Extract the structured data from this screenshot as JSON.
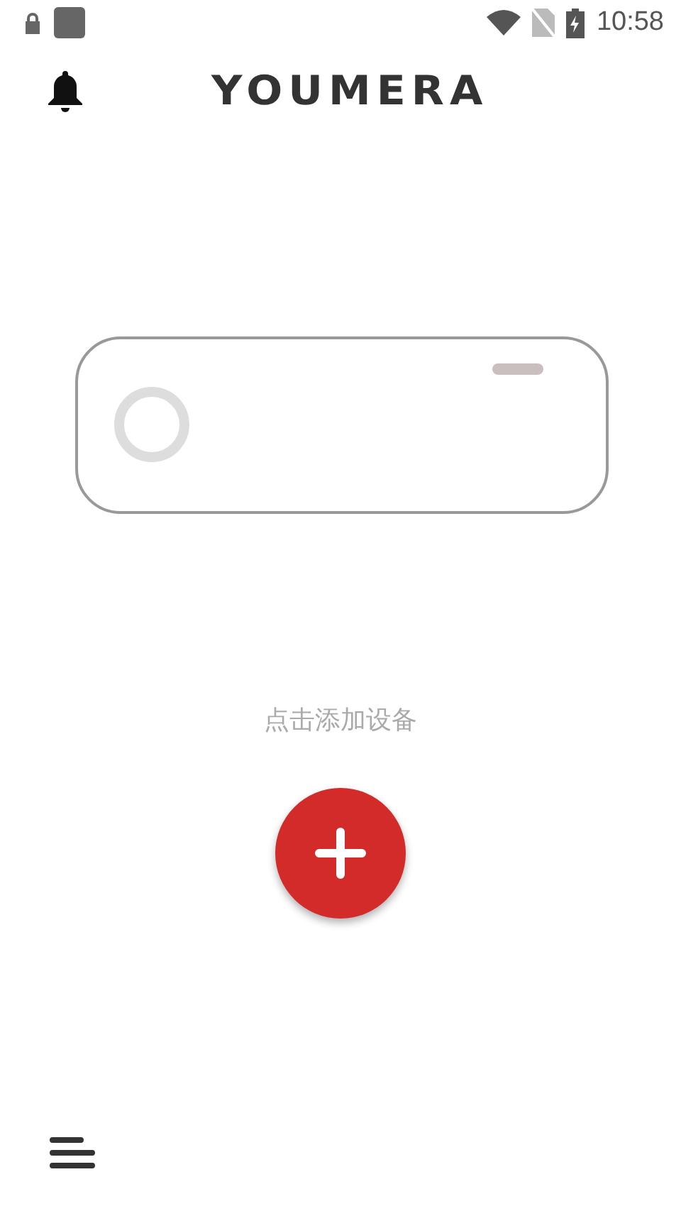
{
  "status_bar": {
    "time": "10:58"
  },
  "header": {
    "logo": "YOUMERA"
  },
  "empty_state": {
    "hint": "点击添加设备"
  }
}
